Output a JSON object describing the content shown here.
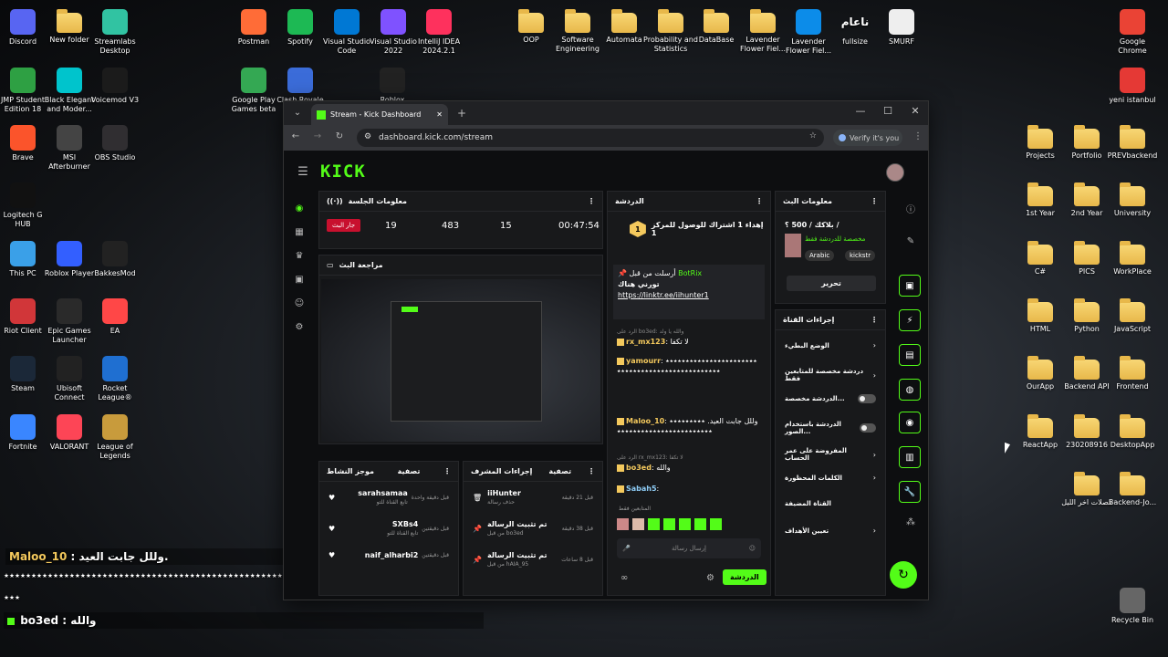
{
  "desktop_icons": [
    {
      "label": "Discord",
      "color": "#5865f2",
      "glyph": "discord-icon"
    },
    {
      "label": "New folder",
      "color": "#f4c95d",
      "glyph": "folder-icon"
    },
    {
      "label": "Streamlabs Desktop",
      "color": "#31c3a2",
      "glyph": "streamlabs-icon"
    },
    {
      "label": "JMP Student Edition 18",
      "color": "#2ea043",
      "glyph": "jmp-icon"
    },
    {
      "label": "Black Elegant and Moder...",
      "color": "#00c4cc",
      "glyph": "canva-icon"
    },
    {
      "label": "Voicemod V3",
      "color": "#1b1b1b",
      "glyph": "voicemod-icon"
    },
    {
      "label": "Brave",
      "color": "#fb542b",
      "glyph": "brave-icon"
    },
    {
      "label": "MSI Afterburner",
      "color": "#444",
      "glyph": "msi-icon"
    },
    {
      "label": "OBS Studio",
      "color": "#302e31",
      "glyph": "obs-icon"
    },
    {
      "label": "Logitech G HUB",
      "color": "#111",
      "glyph": "logitech-icon"
    },
    {
      "label": "This PC",
      "color": "#3aa0e8",
      "glyph": "pc-icon"
    },
    {
      "label": "Roblox Player",
      "color": "#335fff",
      "glyph": "roblox-icon"
    },
    {
      "label": "BakkesMod",
      "color": "#222",
      "glyph": "bakkesmod-icon"
    },
    {
      "label": "Riot Client",
      "color": "#d13639",
      "glyph": "riot-icon"
    },
    {
      "label": "Epic Games Launcher",
      "color": "#2a2a2a",
      "glyph": "epic-icon"
    },
    {
      "label": "EA",
      "color": "#ff4747",
      "glyph": "ea-icon"
    },
    {
      "label": "Steam",
      "color": "#1b2838",
      "glyph": "steam-icon"
    },
    {
      "label": "Ubisoft Connect",
      "color": "#222",
      "glyph": "ubisoft-icon"
    },
    {
      "label": "Rocket League®",
      "color": "#1f6fd1",
      "glyph": "rocket-league-icon"
    },
    {
      "label": "Fortnite",
      "color": "#3a86ff",
      "glyph": "fortnite-icon"
    },
    {
      "label": "VALORANT",
      "color": "#fd4556",
      "glyph": "valorant-icon"
    },
    {
      "label": "League of Legends",
      "color": "#c89b3c",
      "glyph": "lol-icon"
    },
    {
      "label": "Postman",
      "color": "#ff6c37",
      "glyph": "postman-icon"
    },
    {
      "label": "Spotify",
      "color": "#1db954",
      "glyph": "spotify-icon"
    },
    {
      "label": "Visual Studio Code",
      "color": "#0078d4",
      "glyph": "vscode-icon"
    },
    {
      "label": "Visual Studio 2022",
      "color": "#7f52ff",
      "glyph": "vs-icon"
    },
    {
      "label": "IntelliJ IDEA 2024.2.1",
      "color": "#fe315d",
      "glyph": "intellij-icon"
    },
    {
      "label": "Google Play Games beta",
      "color": "#34a853",
      "glyph": "playgames-icon"
    },
    {
      "label": "Clash Royale",
      "color": "#3b6cd9",
      "glyph": "clash-icon"
    },
    {
      "label": "Roblox",
      "color": "#222",
      "glyph": "roblox-studio-icon"
    },
    {
      "label": "OOP",
      "glyph": "folder-icon"
    },
    {
      "label": "Software Engineering",
      "glyph": "folder-icon"
    },
    {
      "label": "Automata",
      "glyph": "folder-icon"
    },
    {
      "label": "Probability and Statistics",
      "glyph": "folder-icon"
    },
    {
      "label": "DataBase",
      "glyph": "folder-icon"
    },
    {
      "label": "Lavender Flower Fiel...",
      "glyph": "folder-icon"
    },
    {
      "label": "Lavender Flower Fiel...",
      "color": "#0c8ce9",
      "glyph": "edge-icon"
    },
    {
      "label": "fullsize",
      "glyph": "arabic-logo-icon"
    },
    {
      "label": "SMURF",
      "color": "#eee",
      "glyph": "file-icon"
    },
    {
      "label": "Google Chrome",
      "color": "#ea4335",
      "glyph": "chrome-icon"
    },
    {
      "label": "yeni istanbul",
      "color": "#e53935",
      "glyph": "pdf-icon"
    },
    {
      "label": "Projects",
      "glyph": "folder-icon"
    },
    {
      "label": "Portfolio",
      "glyph": "folder-icon"
    },
    {
      "label": "PREVbackend",
      "glyph": "folder-icon"
    },
    {
      "label": "1st Year",
      "glyph": "folder-icon"
    },
    {
      "label": "2nd Year",
      "glyph": "folder-icon"
    },
    {
      "label": "University",
      "glyph": "folder-icon"
    },
    {
      "label": "C#",
      "glyph": "folder-icon"
    },
    {
      "label": "PICS",
      "glyph": "folder-icon"
    },
    {
      "label": "WorkPlace",
      "glyph": "folder-icon"
    },
    {
      "label": "HTML",
      "glyph": "folder-icon"
    },
    {
      "label": "Python",
      "glyph": "folder-icon"
    },
    {
      "label": "JavaScript",
      "glyph": "folder-icon"
    },
    {
      "label": "OurApp",
      "glyph": "folder-icon"
    },
    {
      "label": "Backend API",
      "glyph": "folder-icon"
    },
    {
      "label": "Frontend",
      "glyph": "folder-icon"
    },
    {
      "label": "ReactApp",
      "glyph": "folder-icon"
    },
    {
      "label": "230208916",
      "glyph": "folder-icon"
    },
    {
      "label": "DesktopApp",
      "glyph": "folder-icon"
    },
    {
      "label": "فصلات اخر الليل",
      "glyph": "folder-icon"
    },
    {
      "label": "Backend-Jo...",
      "glyph": "folder-icon"
    },
    {
      "label": "Recycle Bin",
      "glyph": "recycle-bin-icon"
    }
  ],
  "fullsize_logo_text": "ناعام",
  "overlay": {
    "line1_user": "Maloo_10",
    "line1_text": "وللل جابت العيد.",
    "line2_text": "٭٭٭٭٭٭٭٭٭٭٭٭٭٭٭٭٭٭٭٭٭٭٭٭٭٭٭٭٭٭٭٭٭٭٭٭٭٭٭٭٭٭٭٭٭٭٭٭٭٭٭٭٭٭٭٭٭٭٭٭٭٭٭٭٭٭٭",
    "line3_text": "٭٭٭",
    "line4_user": "bo3ed",
    "line4_text": "والله"
  },
  "browser": {
    "tab_title": "Stream - Kick Dashboard",
    "url": "dashboard.kick.com/stream",
    "verify": "Verify it's you",
    "min": "—",
    "max": "☐",
    "close": "✕"
  },
  "kick": {
    "logo": "KICK",
    "session": {
      "title": "معلومات الجلسة",
      "live_btn": "جار البث",
      "stats": [
        "19",
        "483",
        "15",
        "00:47:54"
      ]
    },
    "preview_title": "مراجعة البث",
    "activity": {
      "title": "موجز النشاط",
      "filter": "تصفية",
      "items": [
        {
          "name": "sarahsamaa",
          "sub": "تابع القناة للتو",
          "time": "قبل دقيقة واحدة"
        },
        {
          "name": "SXBs4",
          "sub": "تابع القناة للتو",
          "time": "قبل دقيقتين"
        },
        {
          "name": "naif_alharbi2",
          "sub": "",
          "time": "قبل دقيقتين"
        }
      ]
    },
    "mod": {
      "title": "إجراءات المشرف",
      "filter": "تصفية",
      "items": [
        {
          "name": "iiHunter",
          "sub": "حذف رسالة",
          "time": "قبل 21 دقيقة"
        },
        {
          "name": "تم تثبيت الرسالة",
          "sub": "من قبل bo3ed",
          "time": "قبل 38 دقيقة"
        },
        {
          "name": "تم تثبيت الرسالة",
          "sub": "من قبل hAIA_95",
          "time": "قبل 8 ساعات"
        }
      ]
    },
    "chat": {
      "title": "الدردشة",
      "goal": "إهداء 1 اشتراك للوصول للمركز 1",
      "goal_num": "1",
      "pinned_by": "أرسلت من قبل",
      "pinned_user": "BotRix",
      "pinned_text": "تورني هناك",
      "pinned_link": "https://linktr.ee/iihunter1",
      "msgs": [
        {
          "reply": "الرد على bo3ed: والله يا ولد",
          "user": "rx_mx123",
          "text": "لا تكفا"
        },
        {
          "reply": "",
          "user": "yamourr",
          "text": "٭٭٭٭٭٭٭٭٭٭٭٭٭٭٭٭٭٭٭٭٭٭٭٭٭٭٭٭٭٭٭٭٭٭٭٭٭٭٭٭٭٭٭٭٭٭٭٭٭"
        },
        {
          "reply": "",
          "user": "Maloo_10",
          "text": "وللل جابت العيد. ٭٭٭٭٭٭٭٭٭٭٭٭٭٭٭٭٭٭٭٭٭٭٭٭٭٭٭٭٭٭٭٭٭"
        },
        {
          "reply": "الرد على rx_mx123: لا تكفا",
          "user": "bo3ed",
          "text": "والله"
        },
        {
          "reply": "",
          "user": "Sabah5",
          "text": ""
        }
      ],
      "followers_only": "المتابعين فقط",
      "placeholder": "إرسال رسالة",
      "send": "الدردشة"
    },
    "stream_info": {
      "title": "معلومات البث",
      "name": "بلاكك / 500 ؟ /",
      "sub": "مخصصة للدردشة فقط",
      "tags": [
        "Arabic",
        "kickstr"
      ],
      "edit": "تحرير"
    },
    "channel": {
      "title": "إجراءات القناة",
      "items": [
        {
          "label": "الوضع البطيء",
          "ctl": "chevron"
        },
        {
          "label": "دردشة مخصصة للمتابعين فقط",
          "ctl": "chevron"
        },
        {
          "label": "الدردشة مخصصة...",
          "ctl": "toggle"
        },
        {
          "label": "الدردشة باستخدام الصور...",
          "ctl": "toggle"
        },
        {
          "label": "المفروضة على عمر الحساب",
          "ctl": "chevron"
        },
        {
          "label": "الكلمات المحظورة",
          "ctl": "chevron"
        },
        {
          "label": "القناة المضيفة",
          "ctl": "none"
        },
        {
          "label": "تعيين الأهداف",
          "ctl": "chevron"
        }
      ]
    }
  }
}
